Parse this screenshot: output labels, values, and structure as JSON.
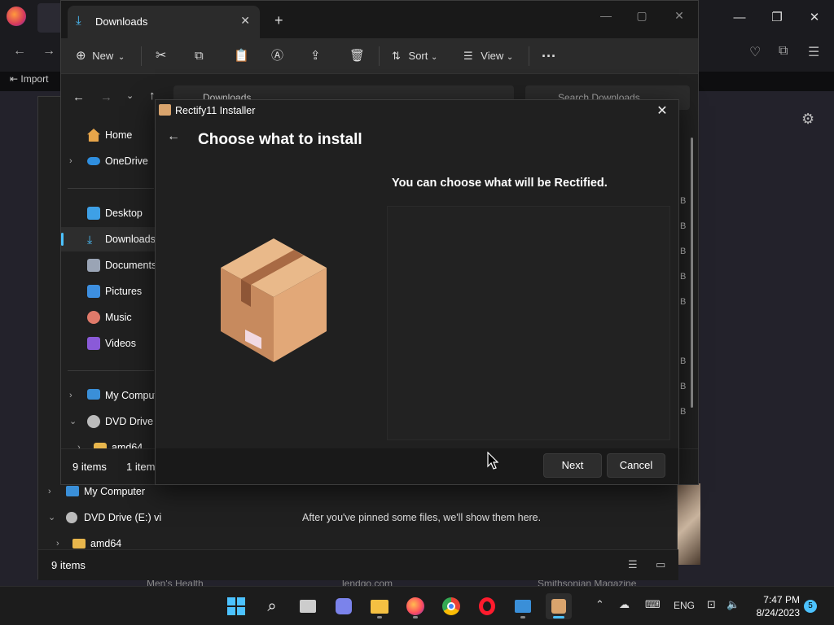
{
  "browser": {
    "import_label": "Import",
    "captions": [
      "Men's Health",
      "lendgo.com",
      "Smithsonian Magazine"
    ]
  },
  "explorer_back": {
    "nav": [
      {
        "label": "My Computer",
        "icon": "monitor-icon"
      },
      {
        "label": "DVD Drive (E:) vi",
        "icon": "dvd-icon"
      },
      {
        "label": "amd64",
        "icon": "folder-icon"
      }
    ],
    "pinned_message": "After you've pinned some files, we'll show them here.",
    "status": "9 items"
  },
  "explorer": {
    "tab_title": "Downloads",
    "toolbar": {
      "new_label": "New",
      "sort_label": "Sort",
      "view_label": "View"
    },
    "address": "Downloads",
    "search_placeholder": "Search Downloads",
    "nav": [
      {
        "label": "Home",
        "icon": "home-icon"
      },
      {
        "label": "OneDrive",
        "icon": "cloud-icon"
      },
      {
        "label": "Desktop",
        "icon": "desktop-icon"
      },
      {
        "label": "Downloads",
        "icon": "download-icon",
        "selected": true
      },
      {
        "label": "Documents",
        "icon": "document-icon"
      },
      {
        "label": "Pictures",
        "icon": "pictures-icon"
      },
      {
        "label": "Music",
        "icon": "music-icon"
      },
      {
        "label": "Videos",
        "icon": "videos-icon"
      },
      {
        "label": "My Comput",
        "icon": "monitor-icon"
      },
      {
        "label": "DVD Drive (",
        "icon": "dvd-icon"
      },
      {
        "label": "amd64",
        "icon": "folder-icon"
      }
    ],
    "size_suffixes": [
      "B",
      "B",
      "B",
      "B",
      "B",
      "B",
      "B",
      "B",
      "B",
      "B"
    ],
    "status": {
      "items": "9 items",
      "selected": "1 item"
    }
  },
  "installer": {
    "window_title": "Rectify11 Installer",
    "heading": "Choose what to install",
    "subheading": "You can choose what will be Rectified.",
    "next_label": "Next",
    "cancel_label": "Cancel"
  },
  "taskbar": {
    "language": "ENG",
    "time": "7:47 PM",
    "date": "8/24/2023",
    "notification_count": "5"
  },
  "colors": {
    "accent": "#4cc2ff",
    "window_bg": "#202020"
  }
}
